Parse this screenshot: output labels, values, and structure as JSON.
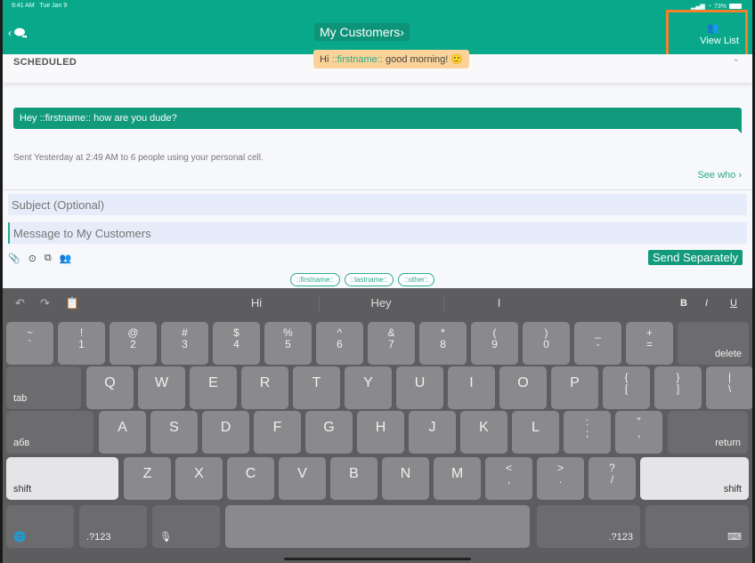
{
  "status_bar": {
    "time": "9:41 AM",
    "date": "Tue Jan 9",
    "battery": "73%"
  },
  "header": {
    "back_icon": "chevron-left-icon",
    "chat_icon": "chat-bubbles-icon",
    "title": "My Customers",
    "title_chevron": "›",
    "view_list_label": "View List",
    "view_list_icon": "group-icon"
  },
  "scheduled": {
    "label": "SCHEDULED",
    "preview_prefix": "Hi ",
    "preview_var": "::firstname::",
    "preview_suffix": " good morning! 🙂"
  },
  "message": {
    "text": "Hey ::firstname:: how are you dude?",
    "sent_info": "Sent Yesterday at 2:49 AM to 6 people using your personal cell.",
    "see_who": "See who ›"
  },
  "compose": {
    "subject_placeholder": "Subject (Optional)",
    "message_placeholder": "Message to My Customers",
    "send_label": "Send Separately",
    "tools": [
      "paperclip-icon",
      "clock-icon",
      "copy-icon",
      "group-icon"
    ],
    "chips": [
      "::firstname::",
      "::lastname::",
      "::other::"
    ]
  },
  "keyboard": {
    "suggestions": [
      "Hi",
      "Hey",
      "I"
    ],
    "format": {
      "bold": "B",
      "italic": "I",
      "underline": "U"
    },
    "row1": [
      {
        "top": "~",
        "bot": "`"
      },
      {
        "top": "!",
        "bot": "1"
      },
      {
        "top": "@",
        "bot": "2"
      },
      {
        "top": "#",
        "bot": "3"
      },
      {
        "top": "$",
        "bot": "4"
      },
      {
        "top": "%",
        "bot": "5"
      },
      {
        "top": "^",
        "bot": "6"
      },
      {
        "top": "&",
        "bot": "7"
      },
      {
        "top": "*",
        "bot": "8"
      },
      {
        "top": "(",
        "bot": "9"
      },
      {
        "top": ")",
        "bot": "0"
      },
      {
        "top": "_",
        "bot": "-"
      },
      {
        "top": "+",
        "bot": "="
      }
    ],
    "delete": "delete",
    "tab": "tab",
    "row2": [
      "Q",
      "W",
      "E",
      "R",
      "T",
      "Y",
      "U",
      "I",
      "O",
      "P"
    ],
    "row2_sym": [
      {
        "top": "{",
        "bot": "["
      },
      {
        "top": "}",
        "bot": "]"
      },
      {
        "top": "|",
        "bot": "\\"
      }
    ],
    "lang": "абв",
    "row3": [
      "A",
      "S",
      "D",
      "F",
      "G",
      "H",
      "J",
      "K",
      "L"
    ],
    "row3_sym": [
      {
        "top": ":",
        "bot": ";"
      },
      {
        "top": "\"",
        "bot": ","
      }
    ],
    "return": "return",
    "shift": "shift",
    "row4": [
      "Z",
      "X",
      "C",
      "V",
      "B",
      "N",
      "M"
    ],
    "row4_sym": [
      {
        "top": "<",
        "bot": ","
      },
      {
        "top": ">",
        "bot": "."
      },
      {
        "top": "?",
        "bot": "/"
      }
    ],
    "numbers": ".?123"
  }
}
